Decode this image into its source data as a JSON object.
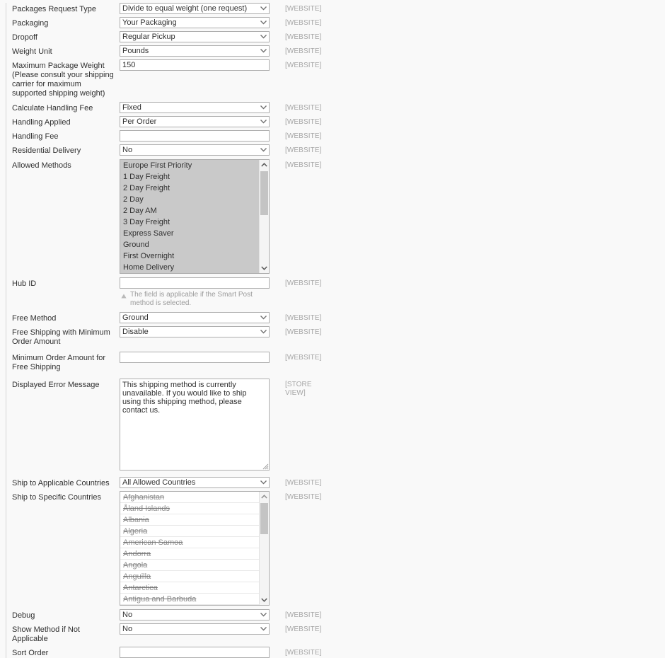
{
  "colors": {
    "page_bg": "#f9f9f9",
    "label_text": "#303030",
    "scope_text": "#a6a6a6",
    "input_border": "#adadad",
    "selected_option_bg": "#c9c9c9",
    "disabled_option_text": "#8f8f8f"
  },
  "scope": {
    "website": "[WEBSITE]",
    "store_view": "[STORE VIEW]"
  },
  "fields": {
    "packages_request_type": {
      "label": "Packages Request Type",
      "value": "Divide to equal weight (one request)",
      "scope": "[WEBSITE]",
      "type": "select"
    },
    "packaging": {
      "label": "Packaging",
      "value": "Your Packaging",
      "scope": "[WEBSITE]",
      "type": "select"
    },
    "dropoff": {
      "label": "Dropoff",
      "value": "Regular Pickup",
      "scope": "[WEBSITE]",
      "type": "select"
    },
    "weight_unit": {
      "label": "Weight Unit",
      "value": "Pounds",
      "scope": "[WEBSITE]",
      "type": "select"
    },
    "maximum_package_weight": {
      "label": "Maximum Package Weight (Please consult your shipping carrier for maximum supported shipping weight)",
      "value": "150",
      "scope": "[WEBSITE]",
      "type": "text"
    },
    "calculate_handling_fee": {
      "label": "Calculate Handling Fee",
      "value": "Fixed",
      "scope": "[WEBSITE]",
      "type": "select"
    },
    "handling_applied": {
      "label": "Handling Applied",
      "value": "Per Order",
      "scope": "[WEBSITE]",
      "type": "select"
    },
    "handling_fee": {
      "label": "Handling Fee",
      "value": "",
      "scope": "[WEBSITE]",
      "type": "text"
    },
    "residential_delivery": {
      "label": "Residential Delivery",
      "value": "No",
      "scope": "[WEBSITE]",
      "type": "select"
    },
    "allowed_methods": {
      "label": "Allowed Methods",
      "scope": "[WEBSITE]",
      "type": "multiselect",
      "all_selected": true,
      "options": [
        "Europe First Priority",
        "1 Day Freight",
        "2 Day Freight",
        "2 Day",
        "2 Day AM",
        "3 Day Freight",
        "Express Saver",
        "Ground",
        "First Overnight",
        "Home Delivery"
      ]
    },
    "hub_id": {
      "label": "Hub ID",
      "value": "",
      "scope": "[WEBSITE]",
      "type": "text",
      "note": "The field is applicable if the Smart Post method is selected."
    },
    "free_method": {
      "label": "Free Method",
      "value": "Ground",
      "scope": "[WEBSITE]",
      "type": "select"
    },
    "free_shipping_with_minimum_order_amount": {
      "label": "Free Shipping with Minimum Order Amount",
      "value": "Disable",
      "scope": "[WEBSITE]",
      "type": "select"
    },
    "minimum_order_amount_for_free_shipping": {
      "label": "Minimum Order Amount for Free Shipping",
      "value": "",
      "scope": "[WEBSITE]",
      "type": "text"
    },
    "displayed_error_message": {
      "label": "Displayed Error Message",
      "value": "This shipping method is currently unavailable. If you would like to ship using this shipping method, please contact us.",
      "scope": "[STORE VIEW]",
      "type": "textarea"
    },
    "ship_to_applicable_countries": {
      "label": "Ship to Applicable Countries",
      "value": "All Allowed Countries",
      "scope": "[WEBSITE]",
      "type": "select"
    },
    "ship_to_specific_countries": {
      "label": "Ship to Specific Countries",
      "scope": "[WEBSITE]",
      "type": "multiselect",
      "disabled": true,
      "options": [
        "Afghanistan",
        "Åland Islands",
        "Albania",
        "Algeria",
        "American Samoa",
        "Andorra",
        "Angola",
        "Anguilla",
        "Antarctica",
        "Antigua and Barbuda"
      ]
    },
    "debug": {
      "label": "Debug",
      "value": "No",
      "scope": "[WEBSITE]",
      "type": "select"
    },
    "show_method_if_not_applicable": {
      "label": "Show Method if Not Applicable",
      "value": "No",
      "scope": "[WEBSITE]",
      "type": "select"
    },
    "sort_order": {
      "label": "Sort Order",
      "value": "",
      "scope": "[WEBSITE]",
      "type": "text"
    }
  }
}
